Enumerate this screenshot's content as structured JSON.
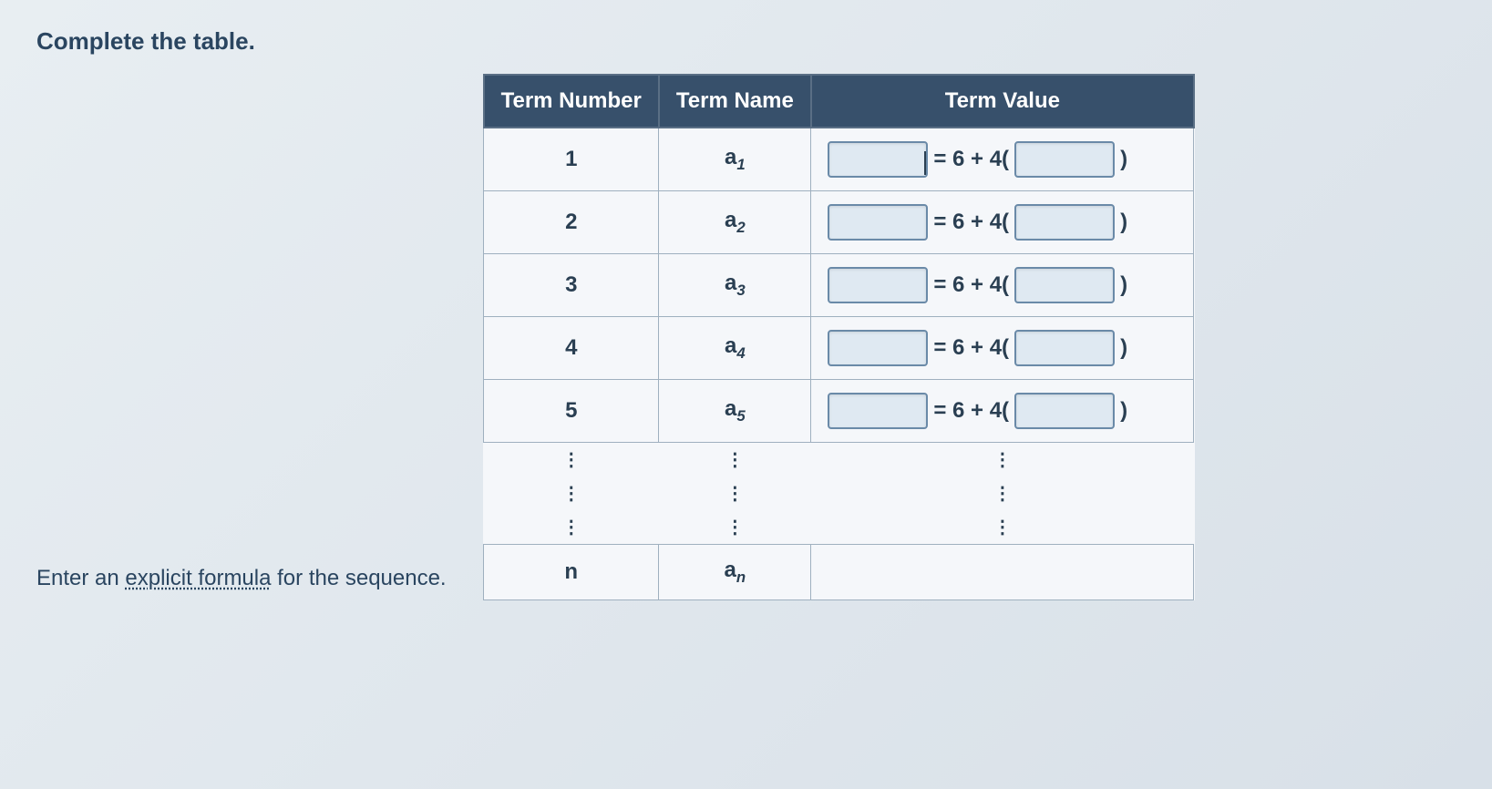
{
  "instruction": "Complete the table.",
  "formula_prompt_pre": "Enter an ",
  "formula_prompt_link": "explicit formula",
  "formula_prompt_post": " for the sequence.",
  "headers": {
    "col1": "Term Number",
    "col2": "Term Name",
    "col3": "Term Value"
  },
  "rows": [
    {
      "num": "1",
      "name_base": "a",
      "name_sub": "1",
      "eq": "= 6 + 4(",
      "close": ")",
      "cursor": true
    },
    {
      "num": "2",
      "name_base": "a",
      "name_sub": "2",
      "eq": "= 6 + 4(",
      "close": ")",
      "cursor": false
    },
    {
      "num": "3",
      "name_base": "a",
      "name_sub": "3",
      "eq": "= 6 + 4(",
      "close": ")",
      "cursor": false
    },
    {
      "num": "4",
      "name_base": "a",
      "name_sub": "4",
      "eq": "= 6 + 4(",
      "close": ")",
      "cursor": false
    },
    {
      "num": "5",
      "name_base": "a",
      "name_sub": "5",
      "eq": "= 6 + 4(",
      "close": ")",
      "cursor": false
    }
  ],
  "vdots": "⋮",
  "final_row": {
    "num": "n",
    "name_base": "a",
    "name_sub": "n"
  }
}
